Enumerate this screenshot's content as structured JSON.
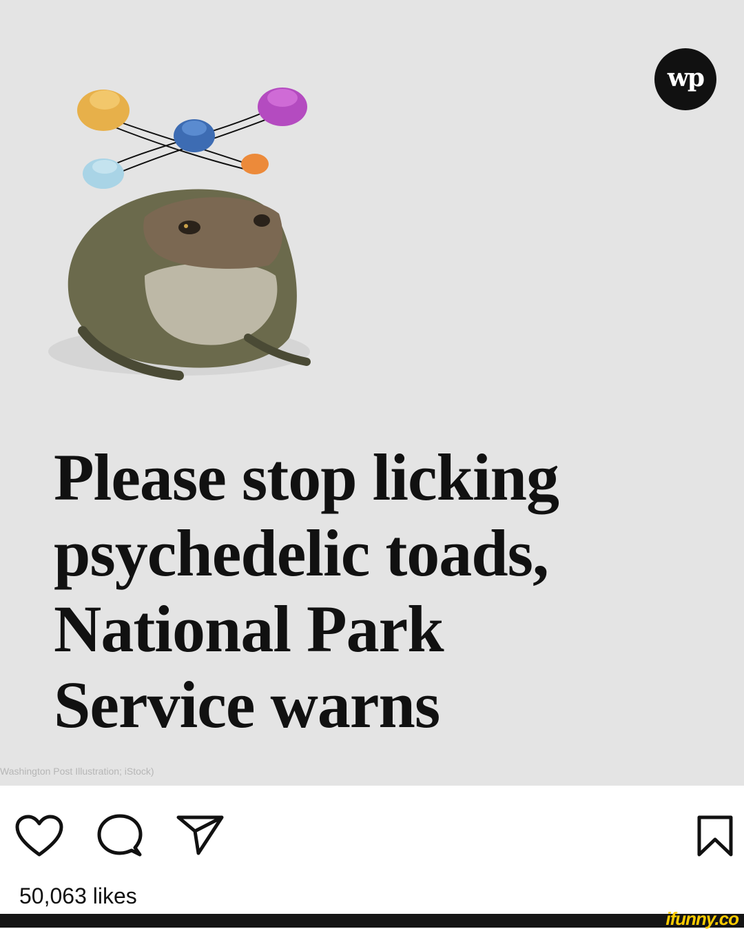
{
  "post": {
    "headline_lines": [
      "Please stop licking",
      "psychedelic toads,",
      "National Park",
      "Service warns"
    ],
    "image_credit": "Washington Post Illustration; iStock)",
    "logo_text": "wp"
  },
  "actions": {
    "like_icon": "heart-icon",
    "comment_icon": "comment-icon",
    "share_icon": "paper-plane-icon",
    "save_icon": "bookmark-icon"
  },
  "likes_text": "50,063 likes",
  "watermark": "ifunny.co",
  "colors": {
    "image_background": "#e4e4e4",
    "text": "#111111",
    "watermark": "#ffcc00"
  }
}
